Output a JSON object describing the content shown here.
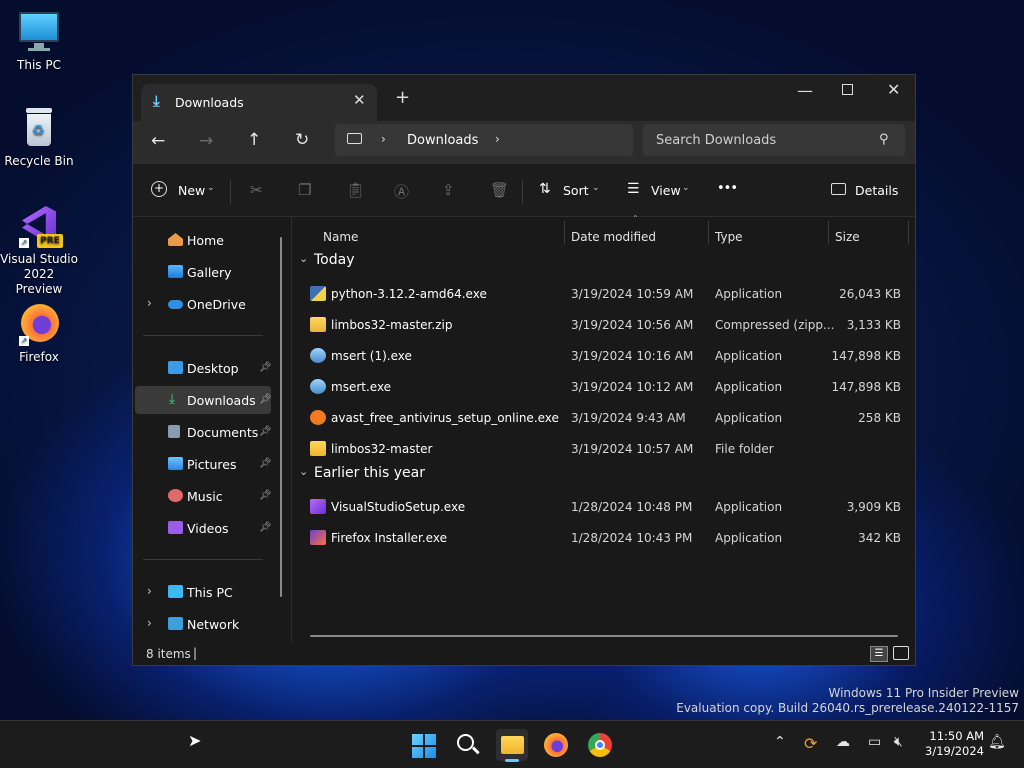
{
  "desktop": {
    "icons": [
      {
        "label": "This PC"
      },
      {
        "label": "Recycle Bin"
      },
      {
        "label": "Visual Studio 2022 Preview",
        "badge": "PRE"
      },
      {
        "label": "Firefox"
      }
    ],
    "watermark_line1": "Windows 11 Pro Insider Preview",
    "watermark_line2": "Evaluation copy. Build 26040.rs_prerelease.240122-1157"
  },
  "window": {
    "tab_title": "Downloads",
    "address_segment": "Downloads",
    "search_placeholder": "Search Downloads",
    "toolbar": {
      "new_label": "New",
      "sort_label": "Sort",
      "view_label": "View",
      "more_label": "•••",
      "details_label": "Details"
    },
    "nav": {
      "home": "Home",
      "gallery": "Gallery",
      "onedrive": "OneDrive",
      "desktop": "Desktop",
      "downloads": "Downloads",
      "documents": "Documents",
      "pictures": "Pictures",
      "music": "Music",
      "videos": "Videos",
      "thispc": "This PC",
      "network": "Network"
    },
    "columns": {
      "name": "Name",
      "date": "Date modified",
      "type": "Type",
      "size": "Size"
    },
    "groups": [
      {
        "label": "Today",
        "files": [
          {
            "name": "python-3.12.2-amd64.exe",
            "date": "3/19/2024 10:59 AM",
            "type": "Application",
            "size": "26,043 KB",
            "icon": "python-installer-icon"
          },
          {
            "name": "limbos32-master.zip",
            "date": "3/19/2024 10:56 AM",
            "type": "Compressed (zipp...",
            "size": "3,133 KB",
            "icon": "zip-folder-icon"
          },
          {
            "name": "msert (1).exe",
            "date": "3/19/2024 10:16 AM",
            "type": "Application",
            "size": "147,898 KB",
            "icon": "msert-icon"
          },
          {
            "name": "msert.exe",
            "date": "3/19/2024 10:12 AM",
            "type": "Application",
            "size": "147,898 KB",
            "icon": "msert-icon"
          },
          {
            "name": "avast_free_antivirus_setup_online.exe",
            "date": "3/19/2024 9:43 AM",
            "type": "Application",
            "size": "258 KB",
            "icon": "avast-icon"
          },
          {
            "name": "limbos32-master",
            "date": "3/19/2024 10:57 AM",
            "type": "File folder",
            "size": "",
            "icon": "folder-icon"
          }
        ]
      },
      {
        "label": "Earlier this year",
        "files": [
          {
            "name": "VisualStudioSetup.exe",
            "date": "1/28/2024 10:48 PM",
            "type": "Application",
            "size": "3,909 KB",
            "icon": "visual-studio-icon"
          },
          {
            "name": "Firefox Installer.exe",
            "date": "1/28/2024 10:43 PM",
            "type": "Application",
            "size": "342 KB",
            "icon": "firefox-installer-icon"
          }
        ]
      }
    ],
    "status_text": "8 items",
    "status_cursor": "|"
  },
  "taskbar": {
    "time": "11:50 AM",
    "date": "3/19/2024"
  },
  "colors": {
    "accent": "#60cdff",
    "selected_nav": "#3a3a3a",
    "folder": "#f3c74e"
  }
}
